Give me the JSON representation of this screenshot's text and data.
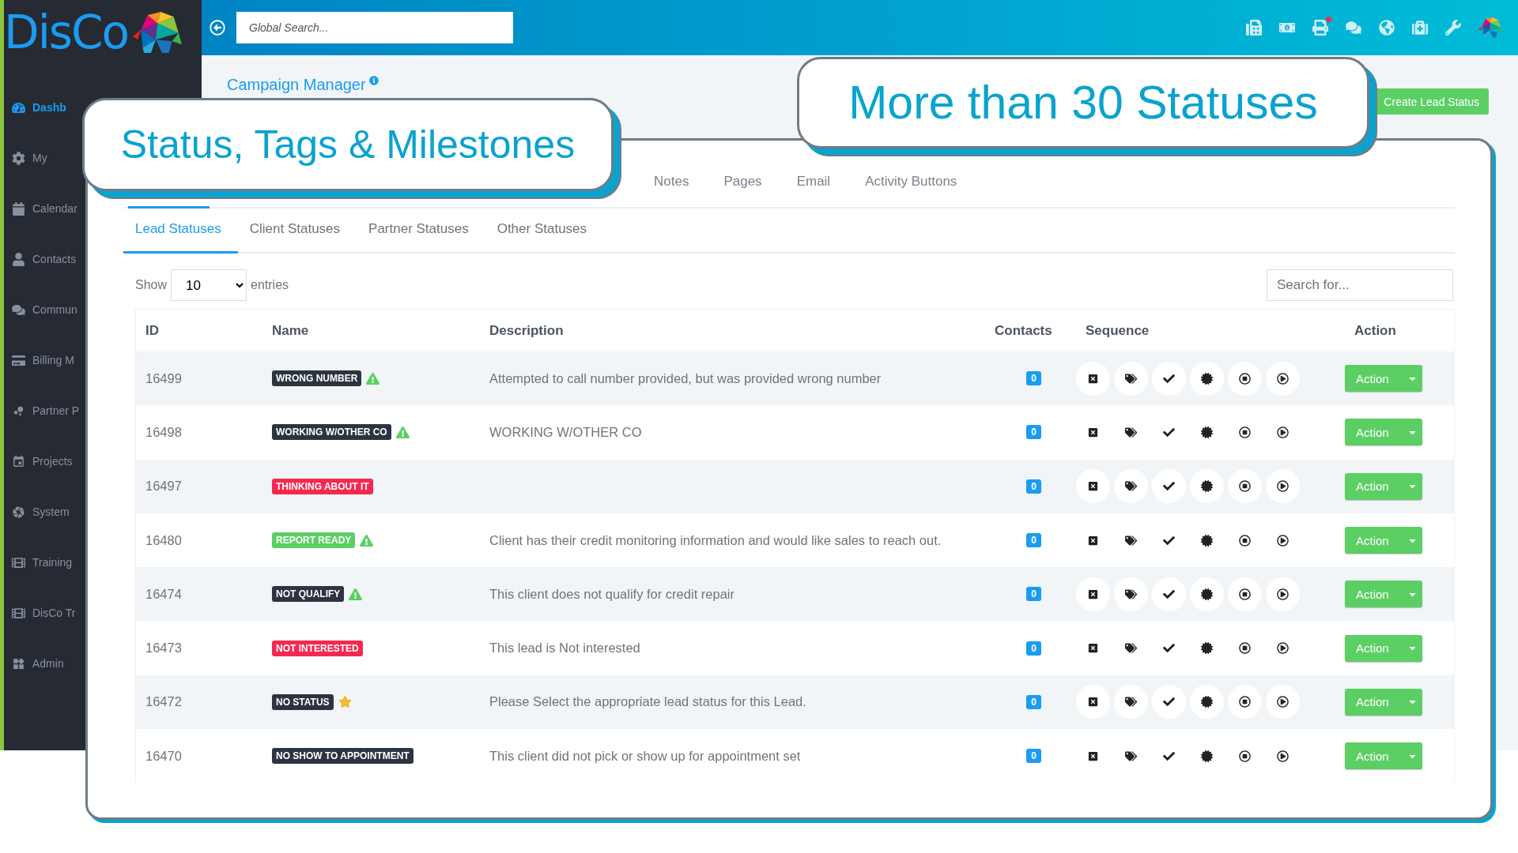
{
  "sidebar": {
    "logo": "DisCo",
    "items": [
      {
        "label": "Dashb",
        "selected": true
      },
      {
        "label": "My",
        "selected": false
      },
      {
        "label": "Calendar",
        "selected": false
      },
      {
        "label": "Contacts",
        "selected": false
      },
      {
        "label": "Commun",
        "selected": false
      },
      {
        "label": "Billing M",
        "selected": false
      },
      {
        "label": "Partner P",
        "selected": false
      },
      {
        "label": "Projects",
        "selected": false
      },
      {
        "label": "System",
        "selected": false
      },
      {
        "label": "Training",
        "selected": false
      },
      {
        "label": "DisCo Tr",
        "selected": false
      },
      {
        "label": "Admin",
        "selected": false
      }
    ]
  },
  "topbar": {
    "search": {
      "placeholder": "Global Search..."
    }
  },
  "page": {
    "title": "Campaign Manager",
    "create_button": "Create Lead Status"
  },
  "callouts": [
    "Status, Tags & Milestones",
    "More than 30 Statuses"
  ],
  "tabs": [
    {
      "label": "Notes",
      "selected": false
    },
    {
      "label": "Pages",
      "selected": false
    },
    {
      "label": "Email",
      "selected": false
    },
    {
      "label": "Activity Buttons",
      "selected": false
    }
  ],
  "subtabs": [
    {
      "label": "Lead Statuses",
      "selected": true
    },
    {
      "label": "Client Statuses",
      "selected": false
    },
    {
      "label": "Partner Statuses",
      "selected": false
    },
    {
      "label": "Other Statuses",
      "selected": false
    }
  ],
  "table_controls": {
    "show": "Show",
    "entries_value": "10",
    "entries": "entries",
    "search": {
      "placeholder": "Search for..."
    }
  },
  "table": {
    "columns": [
      "ID",
      "Name",
      "Description",
      "Contacts",
      "Sequence",
      "Action"
    ],
    "rows": [
      {
        "id": "16499",
        "name": "WRONG NUMBER",
        "color": "#2c3440",
        "warning": true,
        "starred": false,
        "description": "Attempted to call number provided, but was provided wrong number",
        "contacts": "0",
        "action": "Action"
      },
      {
        "id": "16498",
        "name": "WORKING W/OTHER CO",
        "color": "#2c3440",
        "warning": true,
        "starred": false,
        "description": "WORKING W/OTHER CO",
        "contacts": "0",
        "action": "Action"
      },
      {
        "id": "16497",
        "name": "THINKING ABOUT IT",
        "color": "#f5294f",
        "warning": false,
        "starred": false,
        "contacts": "0",
        "action": "Action"
      },
      {
        "id": "16480",
        "name": "REPORT READY",
        "color": "#5ccf64",
        "warning": true,
        "starred": false,
        "description": "Client has their credit monitoring information and would like sales to reach out.",
        "contacts": "0",
        "action": "Action"
      },
      {
        "id": "16474",
        "name": "NOT QUALIFY",
        "color": "#2c3440",
        "warning": true,
        "starred": false,
        "description": "This client does not qualify for credit repair",
        "contacts": "0",
        "action": "Action"
      },
      {
        "id": "16473",
        "name": "NOT INTERESTED",
        "color": "#f5294f",
        "warning": false,
        "starred": false,
        "description": "This lead is Not interested",
        "contacts": "0",
        "action": "Action"
      },
      {
        "id": "16472",
        "name": "NO STATUS",
        "color": "#2c3440",
        "warning": false,
        "starred": true,
        "description": "Please Select the appropriate lead status for this Lead.",
        "contacts": "0",
        "action": "Action"
      },
      {
        "id": "16470",
        "name": "NO SHOW TO APPOINTMENT",
        "color": "#2c3440",
        "warning": false,
        "starred": false,
        "description": "This client did not pick or show up for appointment set",
        "contacts": "0",
        "action": "Action"
      }
    ]
  }
}
